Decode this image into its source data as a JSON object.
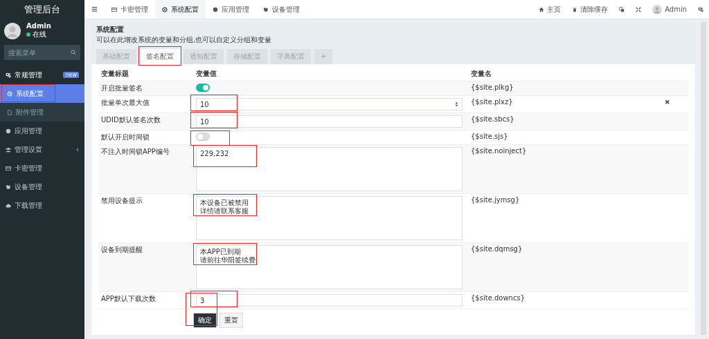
{
  "sidebar": {
    "title": "管理后台",
    "user": {
      "name": "Admin",
      "status": "在线"
    },
    "search": {
      "placeholder": "搜索菜单"
    },
    "items": [
      {
        "label": "常规管理",
        "badge": "new",
        "selected": false,
        "highlighted": false,
        "kind": "group"
      },
      {
        "label": "系统配置",
        "selected": true,
        "highlighted": true,
        "kind": "sub"
      },
      {
        "label": "附件管理",
        "selected": false,
        "highlighted": false,
        "kind": "sub"
      },
      {
        "label": "应用管理",
        "selected": false,
        "highlighted": false,
        "kind": "item"
      },
      {
        "label": "管理设置",
        "selected": false,
        "highlighted": false,
        "kind": "item",
        "caret": "‹"
      },
      {
        "label": "卡密管理",
        "selected": false,
        "highlighted": false,
        "kind": "item"
      },
      {
        "label": "设备管理",
        "selected": false,
        "highlighted": false,
        "kind": "item"
      },
      {
        "label": "下载管理",
        "selected": false,
        "highlighted": false,
        "kind": "item"
      }
    ]
  },
  "top_tabs": [
    {
      "label": "卡密管理",
      "selected": false
    },
    {
      "label": "系统配置",
      "selected": true
    },
    {
      "label": "应用管理",
      "selected": false
    },
    {
      "label": "设备管理",
      "selected": false
    }
  ],
  "top_right": [
    {
      "label": "主页"
    },
    {
      "label": "清除缓存"
    },
    {
      "label": "Admin"
    }
  ],
  "page": {
    "title": "系统配置",
    "description": "可以在此增改系统的变量和分组,也可以自定义分组和变量"
  },
  "config_tabs": [
    {
      "label": "基础配置",
      "selected": false,
      "highlighted": false
    },
    {
      "label": "签名配置",
      "selected": true,
      "highlighted": true
    },
    {
      "label": "通知配置",
      "selected": false,
      "highlighted": false
    },
    {
      "label": "存储配置",
      "selected": false,
      "highlighted": false
    },
    {
      "label": "字典配置",
      "selected": false,
      "highlighted": false
    },
    {
      "label": "+",
      "selected": false,
      "highlighted": false
    }
  ],
  "table": {
    "columns": [
      "变量标题",
      "变量值",
      "变量名"
    ],
    "rows": [
      {
        "title": "开启批量签名",
        "kind": "toggle",
        "on": true,
        "name": "{$site.plkg}",
        "highlighted": false
      },
      {
        "title": "批量单次最大值",
        "kind": "number",
        "value": "10",
        "name": "{$site.plxz}",
        "highlighted": true,
        "remove": "✖"
      },
      {
        "title": "UDID默认签名次数",
        "kind": "input",
        "value": "10",
        "name": "{$site.sbcs}",
        "highlighted": true
      },
      {
        "title": "默认开启时间锁",
        "kind": "toggle",
        "on": false,
        "name": "{$site.sjs}",
        "highlighted": true
      },
      {
        "title": "不注入时间锁APP编号",
        "kind": "textarea",
        "lines": [
          "229,232"
        ],
        "name": "{$site.noinject}",
        "highlighted": true
      },
      {
        "title": "禁用设备提示",
        "kind": "textarea",
        "lines": [
          "本设备已被禁用",
          "详情请联系客服"
        ],
        "name": "{$site.jymsg}",
        "highlighted": true
      },
      {
        "title": "设备到期提醒",
        "kind": "textarea",
        "lines": [
          "本APP已到期",
          "请前往华阳签续费"
        ],
        "name": "{$site.dqmsg}",
        "highlighted": true
      },
      {
        "title": "APP默认下载次数",
        "kind": "input",
        "value": "3",
        "name": "{$site.downcs}",
        "highlighted": true
      }
    ]
  },
  "buttons": [
    {
      "label": "确定",
      "kind": "primary",
      "highlighted": true
    },
    {
      "label": "重置",
      "kind": "default",
      "highlighted": false
    }
  ]
}
